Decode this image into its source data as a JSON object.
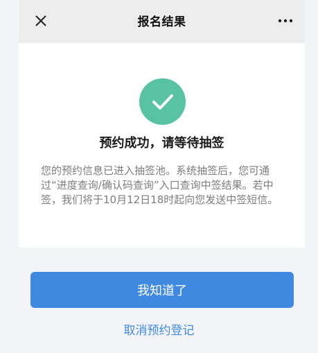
{
  "header": {
    "title": "报名结果",
    "close_icon": "close-icon",
    "more_icon": "more-icon"
  },
  "result": {
    "status_icon": "checkmark-icon",
    "accent_color": "#57c3a0",
    "headline": "预约成功，请等待抽签",
    "description": "您的预约信息已进入抽签池。系统抽签后，您可通过“进度查询/确认码查询”入口查询中签结果。若中签，我们将于10月12日18时起向您发送中签短信。"
  },
  "actions": {
    "confirm_label": "我知道了",
    "cancel_label": "取消预约登记",
    "primary_color": "#3f8ae0"
  }
}
